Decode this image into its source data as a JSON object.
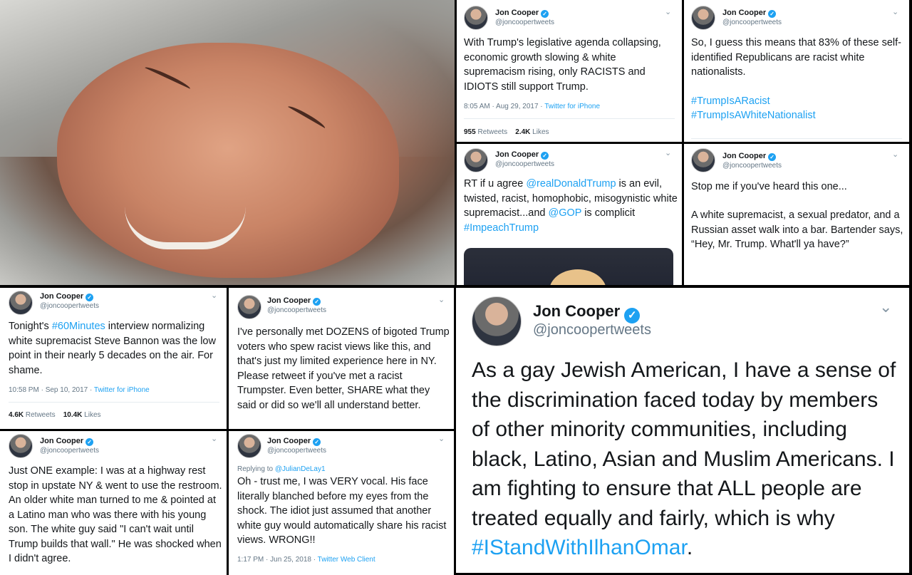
{
  "author": {
    "name": "Jon Cooper",
    "handle": "@joncoopertweets"
  },
  "icons": {
    "verified": "verified-badge-icon",
    "menu": "chevron-down-icon"
  },
  "colors": {
    "link": "#1da1f2",
    "text": "#14171a",
    "muted": "#657786"
  },
  "tweets": [
    {
      "id": "t1",
      "text": "With Trump's legislative agenda collapsing, economic growth slowing & white supremacism rising, only RACISTS and IDIOTS still support Trump.",
      "time": "8:05 AM · Aug 29, 2017 · ",
      "client": "Twitter for iPhone",
      "retweets": "955",
      "retweets_label": " Retweets",
      "likes": "2.4K",
      "likes_label": " Likes"
    },
    {
      "id": "t2",
      "text": "So, I guess this means that 83% of these self-identified Republicans are racist white nationalists.",
      "hashtag1": "#TrumpIsARacist",
      "hashtag2": "#TrumpIsAWhiteNationalist"
    },
    {
      "id": "t3",
      "pre": "RT if u agree ",
      "mention1": "@realDonaldTrump",
      "mid": " is an evil, twisted, racist, homophobic, misogynistic white supremacist...and ",
      "mention2": "@GOP",
      "post": " is complicit ",
      "hashtag": "#ImpeachTrump"
    },
    {
      "id": "t4",
      "line1": "Stop me if you've heard this one...",
      "line2": "A white supremacist, a sexual predator, and a Russian asset walk into a bar. Bartender says, “Hey, Mr. Trump. What'll ya have?”"
    },
    {
      "id": "t5",
      "pre": "Tonight's ",
      "hashtag": "#60Minutes",
      "post": " interview normalizing white supremacist Steve Bannon was the low point in their nearly 5 decades on the air. For shame.",
      "time": "10:58 PM · Sep 10, 2017 · ",
      "client": "Twitter for iPhone",
      "retweets": "4.6K",
      "retweets_label": " Retweets",
      "likes": "10.4K",
      "likes_label": " Likes"
    },
    {
      "id": "t6",
      "text": "I've personally met DOZENS of bigoted Trump voters who spew racist views like this, and that's just my limited experience here in NY. Please retweet if you've met a racist Trumpster. Even better, SHARE what they said or did so we'll all understand better."
    },
    {
      "id": "t7",
      "text": "Just ONE example: I was at a highway rest stop in upstate NY & went to use the restroom. An older white man turned to me & pointed at a Latino man who was there with his young son. The white guy said \"I can't wait until Trump builds that wall.\" He was shocked when I didn't agree."
    },
    {
      "id": "t8",
      "replying_label": "Replying to ",
      "replying_to": "@JulianDeLay1",
      "text": "Oh - trust me, I was VERY vocal. His face literally blanched before my eyes from the shock. The idiot just assumed that another white guy would automatically share his racist views. WRONG!!",
      "time": "1:17 PM · Jun 25, 2018 · ",
      "client": "Twitter Web Client"
    },
    {
      "id": "t9",
      "text": "As a gay Jewish American, I have a sense of the discrimination faced today by members of other minority communities, including black, Latino, Asian and Muslim Americans. I am fighting to ensure that ALL people are treated equally and fairly, which is why ",
      "hashtag": "#IStandWithIlhanOmar",
      "end": "."
    }
  ]
}
